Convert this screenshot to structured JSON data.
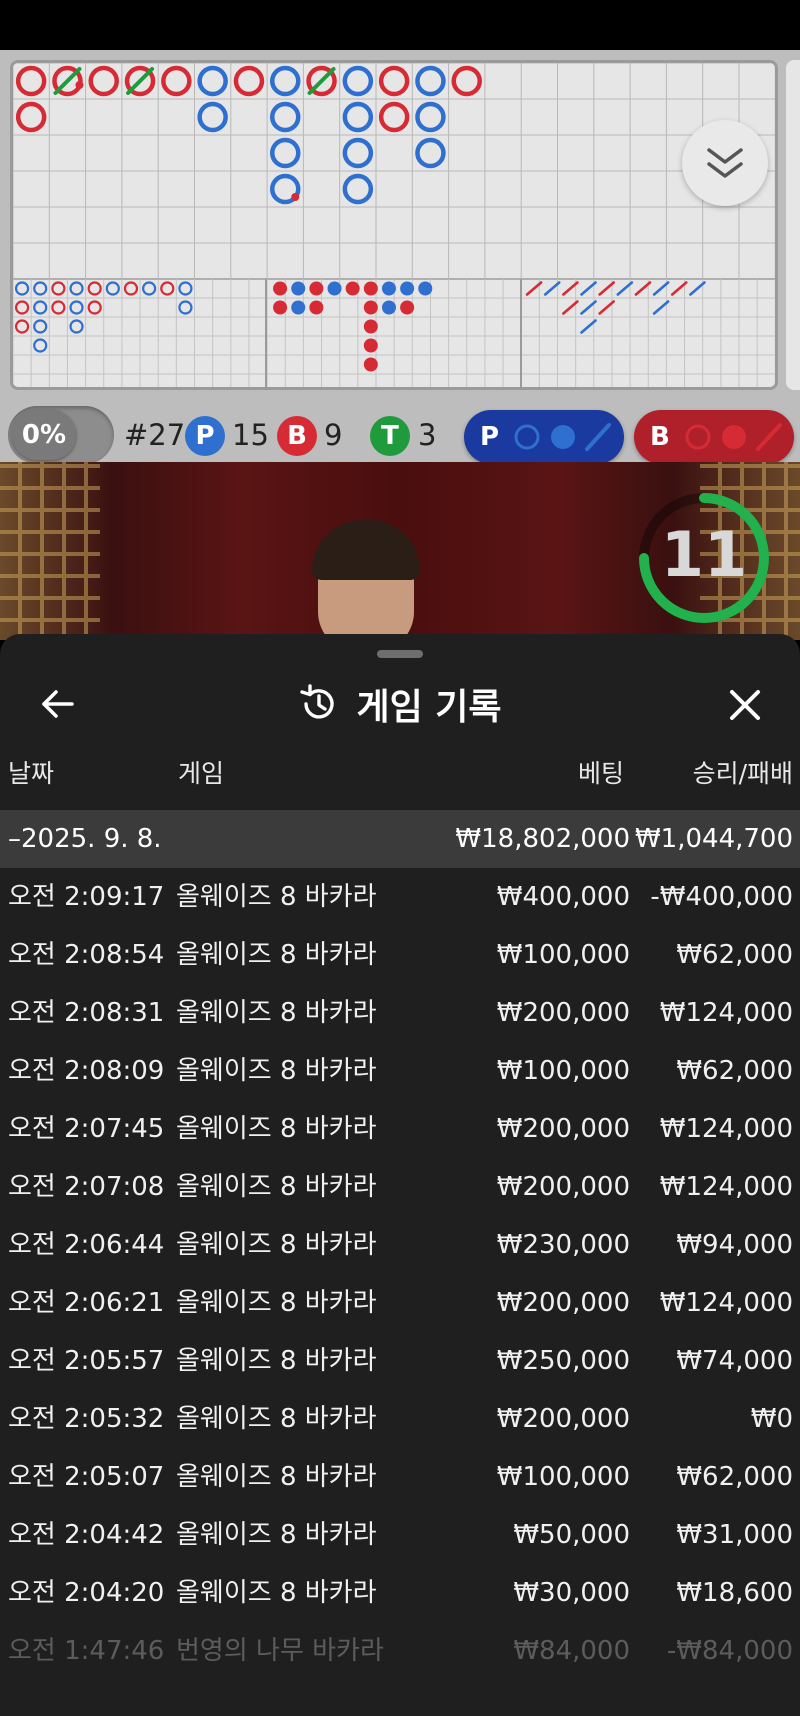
{
  "roadmap": {
    "stats": {
      "percent_label": "0%",
      "round_label": "#27",
      "player_badge": "P",
      "player_count": "15",
      "banker_badge": "B",
      "banker_count": "9",
      "tie_badge": "T",
      "tie_count": "3"
    },
    "predict_player_label": "P",
    "predict_banker_label": "B",
    "colors": {
      "banker": "#d62b35",
      "player": "#2f6fd0",
      "tie": "#1f9a3c"
    }
  },
  "video": {
    "timer": "11"
  },
  "history": {
    "title": "게임 기록",
    "columns": {
      "date": "날짜",
      "game": "게임",
      "bet": "베팅",
      "result": "승리/패배"
    },
    "summary": {
      "date": "–2025. 9. 8.",
      "bet": "₩18,802,000",
      "result": "₩1,044,700"
    },
    "rows": [
      {
        "time": "오전 2:09:17",
        "game": "올웨이즈 8 바카라",
        "bet": "₩400,000",
        "result": "-₩400,000"
      },
      {
        "time": "오전 2:08:54",
        "game": "올웨이즈 8 바카라",
        "bet": "₩100,000",
        "result": "₩62,000"
      },
      {
        "time": "오전 2:08:31",
        "game": "올웨이즈 8 바카라",
        "bet": "₩200,000",
        "result": "₩124,000"
      },
      {
        "time": "오전 2:08:09",
        "game": "올웨이즈 8 바카라",
        "bet": "₩100,000",
        "result": "₩62,000"
      },
      {
        "time": "오전 2:07:45",
        "game": "올웨이즈 8 바카라",
        "bet": "₩200,000",
        "result": "₩124,000"
      },
      {
        "time": "오전 2:07:08",
        "game": "올웨이즈 8 바카라",
        "bet": "₩200,000",
        "result": "₩124,000"
      },
      {
        "time": "오전 2:06:44",
        "game": "올웨이즈 8 바카라",
        "bet": "₩230,000",
        "result": "₩94,000"
      },
      {
        "time": "오전 2:06:21",
        "game": "올웨이즈 8 바카라",
        "bet": "₩200,000",
        "result": "₩124,000"
      },
      {
        "time": "오전 2:05:57",
        "game": "올웨이즈 8 바카라",
        "bet": "₩250,000",
        "result": "₩74,000"
      },
      {
        "time": "오전 2:05:32",
        "game": "올웨이즈 8 바카라",
        "bet": "₩200,000",
        "result": "₩0"
      },
      {
        "time": "오전 2:05:07",
        "game": "올웨이즈 8 바카라",
        "bet": "₩100,000",
        "result": "₩62,000"
      },
      {
        "time": "오전 2:04:42",
        "game": "올웨이즈 8 바카라",
        "bet": "₩50,000",
        "result": "₩31,000"
      },
      {
        "time": "오전 2:04:20",
        "game": "올웨이즈 8 바카라",
        "bet": "₩30,000",
        "result": "₩18,600"
      },
      {
        "time": "오전 1:47:46",
        "game": "번영의 나무 바카라",
        "bet": "₩84,000",
        "result": "-₩84,000"
      }
    ]
  }
}
